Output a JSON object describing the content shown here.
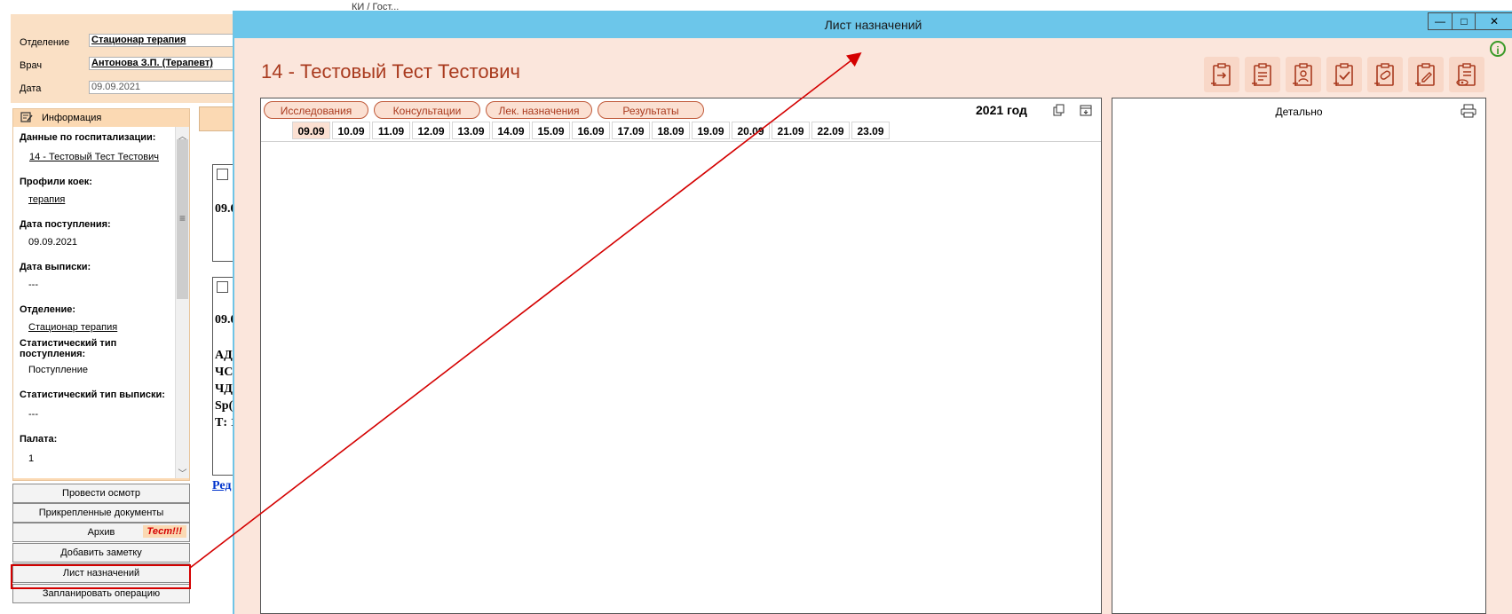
{
  "background": {
    "top_fragment": "КИ / Гост...",
    "form": {
      "department_label": "Отделение",
      "department_value": "Стационар  терапия",
      "doctor_label": "Врач",
      "doctor_value": "Антонова  З.П. (Терапевт)",
      "date_label": "Дата",
      "date_value": "09.09.2021"
    },
    "info_panel": {
      "header": "Информация",
      "hosp_label": "Данные по госпитализации:",
      "hosp_value": "14 - Тестовый Тест Тестович",
      "profiles_label": "Профили коек:",
      "profiles_value": "терапия",
      "admission_label": "Дата поступления:",
      "admission_value": "09.09.2021",
      "discharge_label": "Дата выписки:",
      "discharge_value": "---",
      "department_label": "Отделение:",
      "department_value": "Стационар  терапия",
      "stat_in_label": "Статистический тип поступления:",
      "stat_in_value": "Поступление",
      "stat_out_label": "Статистический тип выписки:",
      "stat_out_value": "---",
      "ward_label": "Палата:",
      "ward_value": "1"
    },
    "cards": {
      "card1_date": "09.0",
      "card2_date": "09.0",
      "card2_lines": [
        "АД",
        "ЧС",
        "ЧД",
        "Sp(",
        "Т: 1"
      ],
      "edit_link": "Ред"
    },
    "buttons": {
      "examine": "Провести осмотр",
      "attached_docs": "Прикрепленные документы",
      "archive": "Архив",
      "archive_tag": "Тест!!!",
      "add_note": "Добавить заметку",
      "prescriptions": "Лист назначений",
      "plan_operation": "Запланировать операцию"
    }
  },
  "modal": {
    "title": "Лист назначений",
    "window_buttons": {
      "minimize": "—",
      "maximize": "□",
      "close": "✕"
    },
    "patient_name": "14 - Тестовый Тест Тестович",
    "tabs": [
      "Исследования",
      "Консультации",
      "Лек. назначения",
      "Результаты"
    ],
    "year": "2021 год",
    "dates": [
      "09.09",
      "10.09",
      "11.09",
      "12.09",
      "13.09",
      "14.09",
      "15.09",
      "16.09",
      "17.09",
      "18.09",
      "19.09",
      "20.09",
      "21.09",
      "22.09",
      "23.09"
    ],
    "selected_date": "09.09",
    "detail_title": "Детально",
    "accent_color": "#a93a1e",
    "titlebar_color": "#6cc6ea"
  },
  "icons": [
    "info-icon",
    "clipboard-import-icon",
    "clipboard-add-icon",
    "clipboard-person-icon",
    "clipboard-check-icon",
    "clipboard-pill-icon",
    "clipboard-edit-icon",
    "clipboard-view-icon",
    "copy-icon",
    "calendar-icon",
    "print-icon"
  ]
}
